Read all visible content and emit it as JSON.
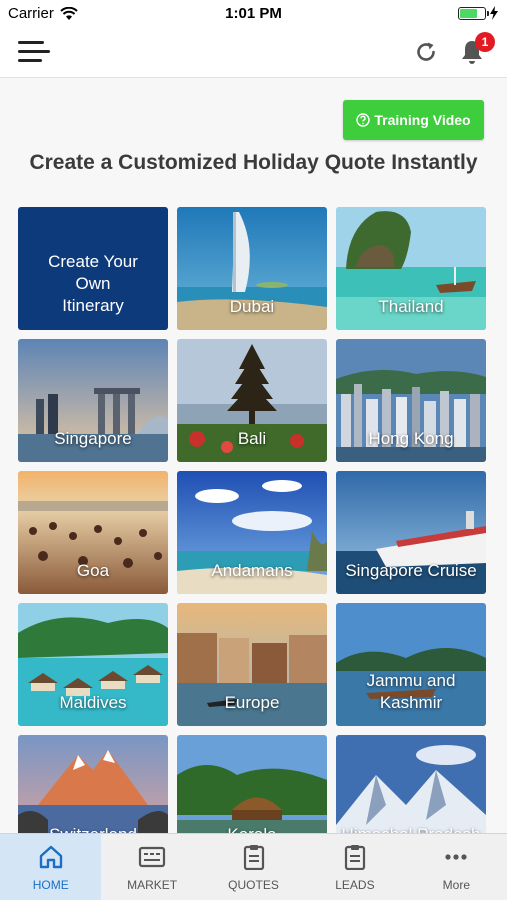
{
  "status": {
    "carrier": "Carrier",
    "time": "1:01 PM"
  },
  "header": {
    "notification_count": "1"
  },
  "training_button": {
    "label": "Training Video"
  },
  "headline": "Create a Customized Holiday Quote Instantly",
  "tiles": [
    {
      "label": "Create Your Own Itinerary",
      "scene": "custom"
    },
    {
      "label": "Dubai",
      "scene": "dubai"
    },
    {
      "label": "Thailand",
      "scene": "thailand"
    },
    {
      "label": "Singapore",
      "scene": "singapore"
    },
    {
      "label": "Bali",
      "scene": "bali"
    },
    {
      "label": "Hong Kong",
      "scene": "hongkong"
    },
    {
      "label": "Goa",
      "scene": "goa"
    },
    {
      "label": "Andamans",
      "scene": "andamans"
    },
    {
      "label": "Singapore Cruise",
      "scene": "cruise"
    },
    {
      "label": "Maldives",
      "scene": "maldives"
    },
    {
      "label": "Europe",
      "scene": "europe"
    },
    {
      "label": "Jammu and Kashmir",
      "scene": "kashmir"
    },
    {
      "label": "Switzerland",
      "scene": "switzerland"
    },
    {
      "label": "Kerala",
      "scene": "kerala"
    },
    {
      "label": "Himachal Pradesh",
      "scene": "himachal"
    }
  ],
  "tabs": [
    {
      "label": "HOME",
      "icon": "home-icon",
      "active": true
    },
    {
      "label": "MARKET",
      "icon": "market-icon",
      "active": false
    },
    {
      "label": "QUOTES",
      "icon": "quotes-icon",
      "active": false
    },
    {
      "label": "LEADS",
      "icon": "leads-icon",
      "active": false
    },
    {
      "label": "More",
      "icon": "more-icon",
      "active": false
    }
  ],
  "colors": {
    "accent_green": "#3ecd3c",
    "badge_red": "#e21b23",
    "active_tab": "#1a6fc4",
    "custom_tile": "#0d3a7a"
  }
}
